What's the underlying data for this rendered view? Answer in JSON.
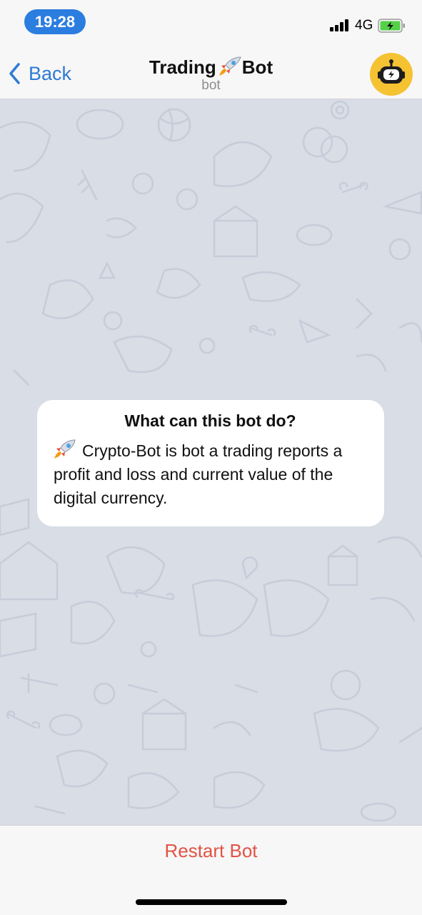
{
  "status_bar": {
    "time": "19:28",
    "network": "4G"
  },
  "nav": {
    "back_label": "Back",
    "title_prefix": "Trading",
    "title_suffix": "Bot",
    "subtitle": "bot",
    "avatar_icon": "astronaut-helmet-icon"
  },
  "card": {
    "title": "What can this bot do?",
    "body": "Crypto-Bot is bot a trading reports a profit and loss and current value of the digital currency.",
    "emoji_icon": "rocket-icon"
  },
  "bottom": {
    "restart_label": "Restart Bot"
  },
  "colors": {
    "accent": "#2b7de0",
    "link": "#2f7ad5",
    "destructive": "#e25344",
    "avatar_bg": "#f5c232",
    "chat_bg": "#d8dde6"
  }
}
